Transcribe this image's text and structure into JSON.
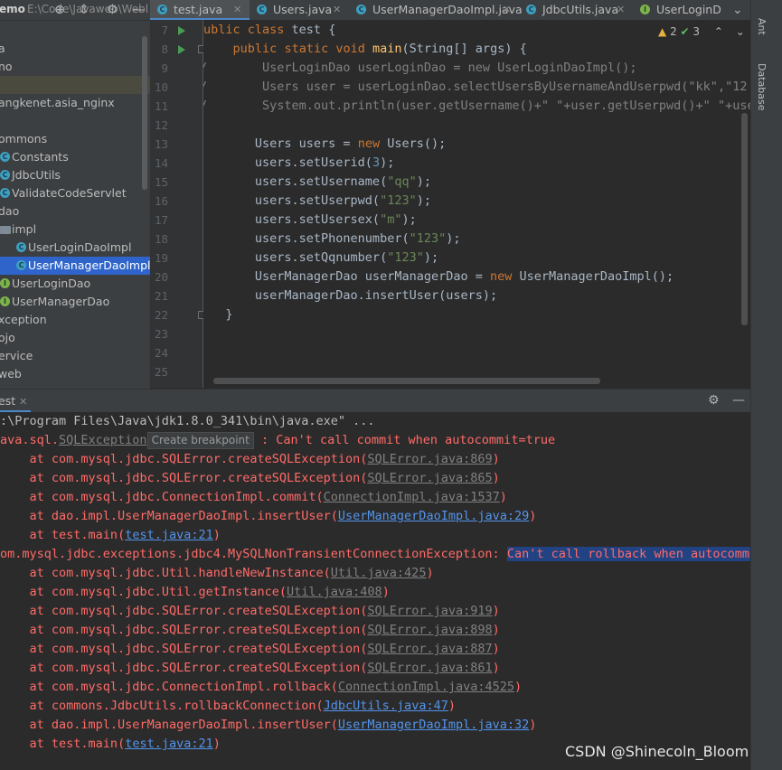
{
  "project": {
    "root_name": "emo",
    "root_path": "E:\\Code\\Javaweb\\Webl",
    "tree": [
      {
        "label": "a",
        "icon": "none",
        "indent": -2
      },
      {
        "label": "no",
        "icon": "none",
        "indent": -2
      },
      {
        "label": "",
        "icon": "none",
        "indent": 0,
        "state": "dim"
      },
      {
        "label": "angkenet.asia_nginx",
        "icon": "none",
        "indent": -2
      },
      {
        "label": "",
        "icon": "none",
        "indent": 0
      },
      {
        "label": "ommons",
        "icon": "none",
        "indent": -2
      },
      {
        "label": "Constants",
        "icon": "class",
        "indent": 0
      },
      {
        "label": "JdbcUtils",
        "icon": "class",
        "indent": 0
      },
      {
        "label": "ValidateCodeServlet",
        "icon": "class",
        "indent": 0
      },
      {
        "label": "dao",
        "icon": "none",
        "indent": -2
      },
      {
        "label": "impl",
        "icon": "folder",
        "indent": 0
      },
      {
        "label": "UserLoginDaoImpl",
        "icon": "class",
        "indent": 18
      },
      {
        "label": "UserManagerDaoImpl",
        "icon": "class",
        "indent": 18,
        "state": "selected"
      },
      {
        "label": "UserLoginDao",
        "icon": "iface",
        "indent": 0
      },
      {
        "label": "UserManagerDao",
        "icon": "iface",
        "indent": 0
      },
      {
        "label": "xception",
        "icon": "none",
        "indent": -2
      },
      {
        "label": "ojo",
        "icon": "none",
        "indent": -2
      },
      {
        "label": "ervice",
        "icon": "none",
        "indent": -2
      },
      {
        "label": "web",
        "icon": "none",
        "indent": -2
      }
    ]
  },
  "tabs": [
    {
      "label": "test.java",
      "icon": "class",
      "active": true
    },
    {
      "label": "Users.java",
      "icon": "class",
      "active": false
    },
    {
      "label": "UserManagerDaoImpl.java",
      "icon": "class",
      "active": false
    },
    {
      "label": "JdbcUtils.java",
      "icon": "class",
      "active": false
    },
    {
      "label": "UserLoginD",
      "icon": "iface",
      "active": false
    }
  ],
  "inspections": {
    "warnings": "2",
    "ok": "3"
  },
  "right_tools": [
    "Ant",
    "Database"
  ],
  "editor": {
    "line_numbers": [
      "7",
      "8",
      "9",
      "10",
      "11",
      "12",
      "13",
      "14",
      "15",
      "16",
      "17",
      "18",
      "19",
      "20",
      "21",
      "22",
      "23",
      "24",
      "25"
    ],
    "lines": [
      "ublic class test {",
      "    public static void main(String[] args) {",
      "        UserLoginDao userLoginDao = new UserLoginDaoImpl();",
      "        Users user = userLoginDao.selectUsersByUsernameAndUserpwd(\"kk\",\"12",
      "        System.out.println(user.getUsername()+\" \"+user.getUserpwd()+\" \"+use",
      "",
      "       Users users = new Users();",
      "       users.setUserid(3);",
      "       users.setUsername(\"qq\");",
      "       users.setUserpwd(\"123\");",
      "       users.setUsersex(\"m\");",
      "       users.setPhonenumber(\"123\");",
      "       users.setQqnumber(\"123\");",
      "       UserManagerDao userManagerDao = new UserManagerDaoImpl();",
      "       userManagerDao.insertUser(users);",
      "   }",
      "",
      "",
      ""
    ]
  },
  "run": {
    "tab_label": "est",
    "console": {
      "command": ":\\Program Files\\Java\\jdk1.8.0_341\\bin\\java.exe\" ...",
      "ex1_prefix": "ava.sql.",
      "ex1_class": "SQLException",
      "tooltip": "Create breakpoint",
      "ex1_message": " : Can't call commit when autocommit=true",
      "trace1": [
        {
          "method": "com.mysql.jdbc.SQLError.createSQLException",
          "loc": "SQLError.java:869",
          "style": "dim"
        },
        {
          "method": "com.mysql.jdbc.SQLError.createSQLException",
          "loc": "SQLError.java:865",
          "style": "dim"
        },
        {
          "method": "com.mysql.jdbc.ConnectionImpl.commit",
          "loc": "ConnectionImpl.java:1537",
          "style": "dim"
        },
        {
          "method": "dao.impl.UserManagerDaoImpl.insertUser",
          "loc": "UserManagerDaoImpl.java:29",
          "style": "link"
        },
        {
          "method": "test.main",
          "loc": "test.java:21",
          "style": "link"
        }
      ],
      "ex2_class": "om.mysql.jdbc.exceptions.jdbc4.MySQLNonTransientConnectionException: ",
      "ex2_message": "Can't call rollback when autocommit=",
      "trace2": [
        {
          "method": "com.mysql.jdbc.Util.handleNewInstance",
          "loc": "Util.java:425",
          "style": "dim"
        },
        {
          "method": "com.mysql.jdbc.Util.getInstance",
          "loc": "Util.java:408",
          "style": "dim"
        },
        {
          "method": "com.mysql.jdbc.SQLError.createSQLException",
          "loc": "SQLError.java:919",
          "style": "dim"
        },
        {
          "method": "com.mysql.jdbc.SQLError.createSQLException",
          "loc": "SQLError.java:898",
          "style": "dim"
        },
        {
          "method": "com.mysql.jdbc.SQLError.createSQLException",
          "loc": "SQLError.java:887",
          "style": "dim"
        },
        {
          "method": "com.mysql.jdbc.SQLError.createSQLException",
          "loc": "SQLError.java:861",
          "style": "dim"
        },
        {
          "method": "com.mysql.jdbc.ConnectionImpl.rollback",
          "loc": "ConnectionImpl.java:4525",
          "style": "dim"
        },
        {
          "method": "commons.JdbcUtils.rollbackConnection",
          "loc": "JdbcUtils.java:47",
          "style": "link"
        },
        {
          "method": "dao.impl.UserManagerDaoImpl.insertUser",
          "loc": "UserManagerDaoImpl.java:32",
          "style": "link"
        },
        {
          "method": "test.main",
          "loc": "test.java:21",
          "style": "link"
        }
      ]
    }
  },
  "watermark": "CSDN @Shinecoln_Bloom",
  "colors": {
    "background": "#2b2b2b",
    "panel": "#3c3f41",
    "error_text": "#ff6b68",
    "link": "#5394ec",
    "selection": "#214283",
    "tree_selection": "#2f65ca"
  }
}
